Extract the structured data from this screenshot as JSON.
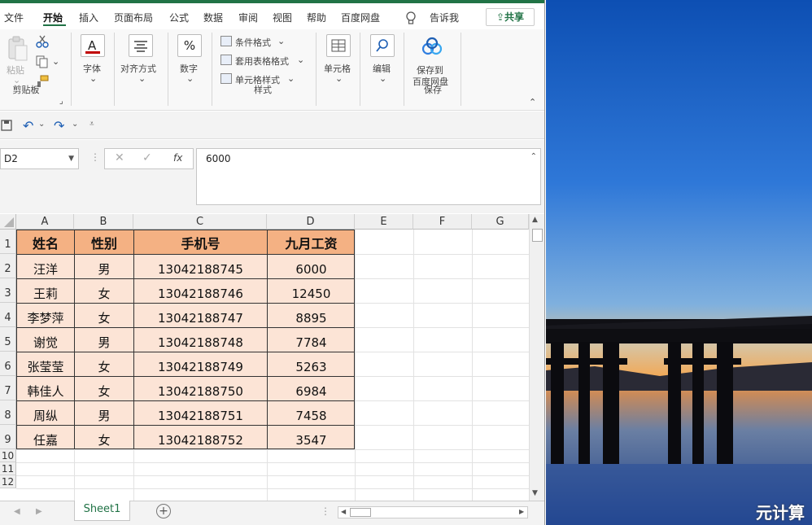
{
  "menu": {
    "tabs": [
      "文件",
      "开始",
      "插入",
      "页面布局",
      "公式",
      "数据",
      "审阅",
      "视图",
      "帮助",
      "百度网盘"
    ],
    "active_tab": "开始",
    "tell_me": "告诉我",
    "share": "共享"
  },
  "ribbon": {
    "clipboard": {
      "paste": "粘贴",
      "group": "剪贴板"
    },
    "font": {
      "label": "字体"
    },
    "alignment": {
      "label": "对齐方式"
    },
    "number": {
      "label": "数字",
      "icon_text": "%"
    },
    "styles": {
      "conditional": "条件格式",
      "table": "套用表格格式",
      "cell_styles": "单元格样式",
      "group": "样式"
    },
    "cells": {
      "label": "单元格"
    },
    "editing": {
      "label": "编辑"
    },
    "save": {
      "line1": "保存到",
      "line2": "百度网盘",
      "group": "保存"
    }
  },
  "formula_bar": {
    "name_box": "D2",
    "value": "6000",
    "fx": "fx"
  },
  "grid": {
    "columns": [
      "A",
      "B",
      "C",
      "D",
      "E",
      "F",
      "G"
    ],
    "rows": [
      "1",
      "2",
      "3",
      "4",
      "5",
      "6",
      "7",
      "8",
      "9",
      "10",
      "11",
      "12"
    ],
    "header": [
      "姓名",
      "性别",
      "手机号",
      "九月工资"
    ],
    "data": [
      [
        "汪洋",
        "男",
        "13042188745",
        "6000"
      ],
      [
        "王莉",
        "女",
        "13042188746",
        "12450"
      ],
      [
        "李梦萍",
        "女",
        "13042188747",
        "8895"
      ],
      [
        "谢觉",
        "男",
        "13042188748",
        "7784"
      ],
      [
        "张莹莹",
        "女",
        "13042188749",
        "5263"
      ],
      [
        "韩佳人",
        "女",
        "13042188750",
        "6984"
      ],
      [
        "周纵",
        "男",
        "13042188751",
        "7458"
      ],
      [
        "任嘉",
        "女",
        "13042188752",
        "3547"
      ]
    ],
    "header_color": "#f4b183",
    "data_color": "#fce4d6"
  },
  "sheets": {
    "active": "Sheet1"
  },
  "watermark": "元计算",
  "colors": {
    "accent": "#217346"
  }
}
